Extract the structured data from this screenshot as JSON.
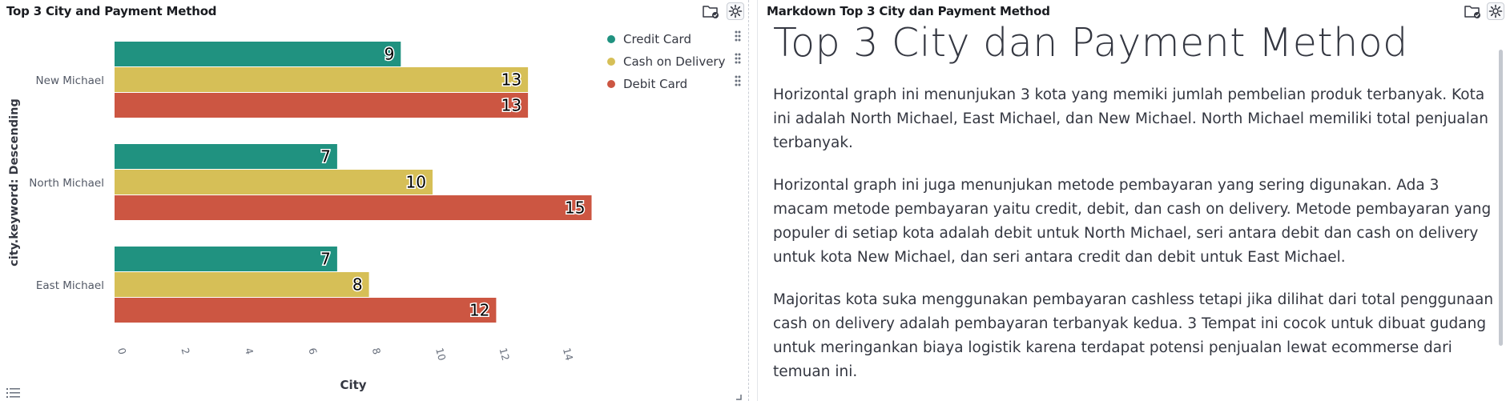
{
  "left_panel": {
    "title": "Top 3 City and Payment Method",
    "icons": [
      "folder-check-icon",
      "gear-icon",
      "list-icon"
    ]
  },
  "chart_data": {
    "type": "bar",
    "orientation": "horizontal",
    "categories": [
      "New Michael",
      "North Michael",
      "East Michael"
    ],
    "series": [
      {
        "name": "Credit Card",
        "color": "#209280",
        "values": [
          9,
          7,
          7
        ]
      },
      {
        "name": "Cash on Delivery",
        "color": "#d6bf57",
        "values": [
          13,
          10,
          8
        ]
      },
      {
        "name": "Debit Card",
        "color": "#cc5642",
        "values": [
          13,
          15,
          12
        ]
      }
    ],
    "value_axis_label": "City",
    "category_axis_label": "city.keyword: Descending",
    "value_ticks": [
      "0",
      "2",
      "4",
      "6",
      "8",
      "10",
      "12",
      "14"
    ],
    "xlim": [
      0,
      15
    ],
    "legend_position": "top-right",
    "grid": false
  },
  "right_panel": {
    "title": "Markdown Top 3 City dan Payment Method",
    "heading": "Top 3 City dan Payment Method",
    "paragraphs": [
      "Horizontal graph ini menunjukan 3 kota yang memiki jumlah pembelian produk terbanyak. Kota ini adalah North Michael, East Michael, dan New Michael. North Michael memiliki total penjualan terbanyak.",
      "Horizontal graph ini juga menunjukan metode pembayaran yang sering digunakan. Ada 3 macam metode pembayaran yaitu credit, debit, dan cash on delivery. Metode pembayaran yang populer di setiap kota adalah debit untuk North Michael, seri antara debit dan cash on delivery untuk kota New Michael, dan seri antara credit dan debit untuk East Michael.",
      "Majoritas kota suka menggunakan pembayaran cashless tetapi jika dilihat dari total penggunaan cash on delivery adalah pembayaran terbanyak kedua. 3 Tempat ini cocok untuk dibuat gudang untuk meringankan biaya logistik karena terdapat potensi penjualan lewat ecommerse dari temuan ini."
    ],
    "icons": [
      "folder-check-icon",
      "gear-icon"
    ]
  }
}
